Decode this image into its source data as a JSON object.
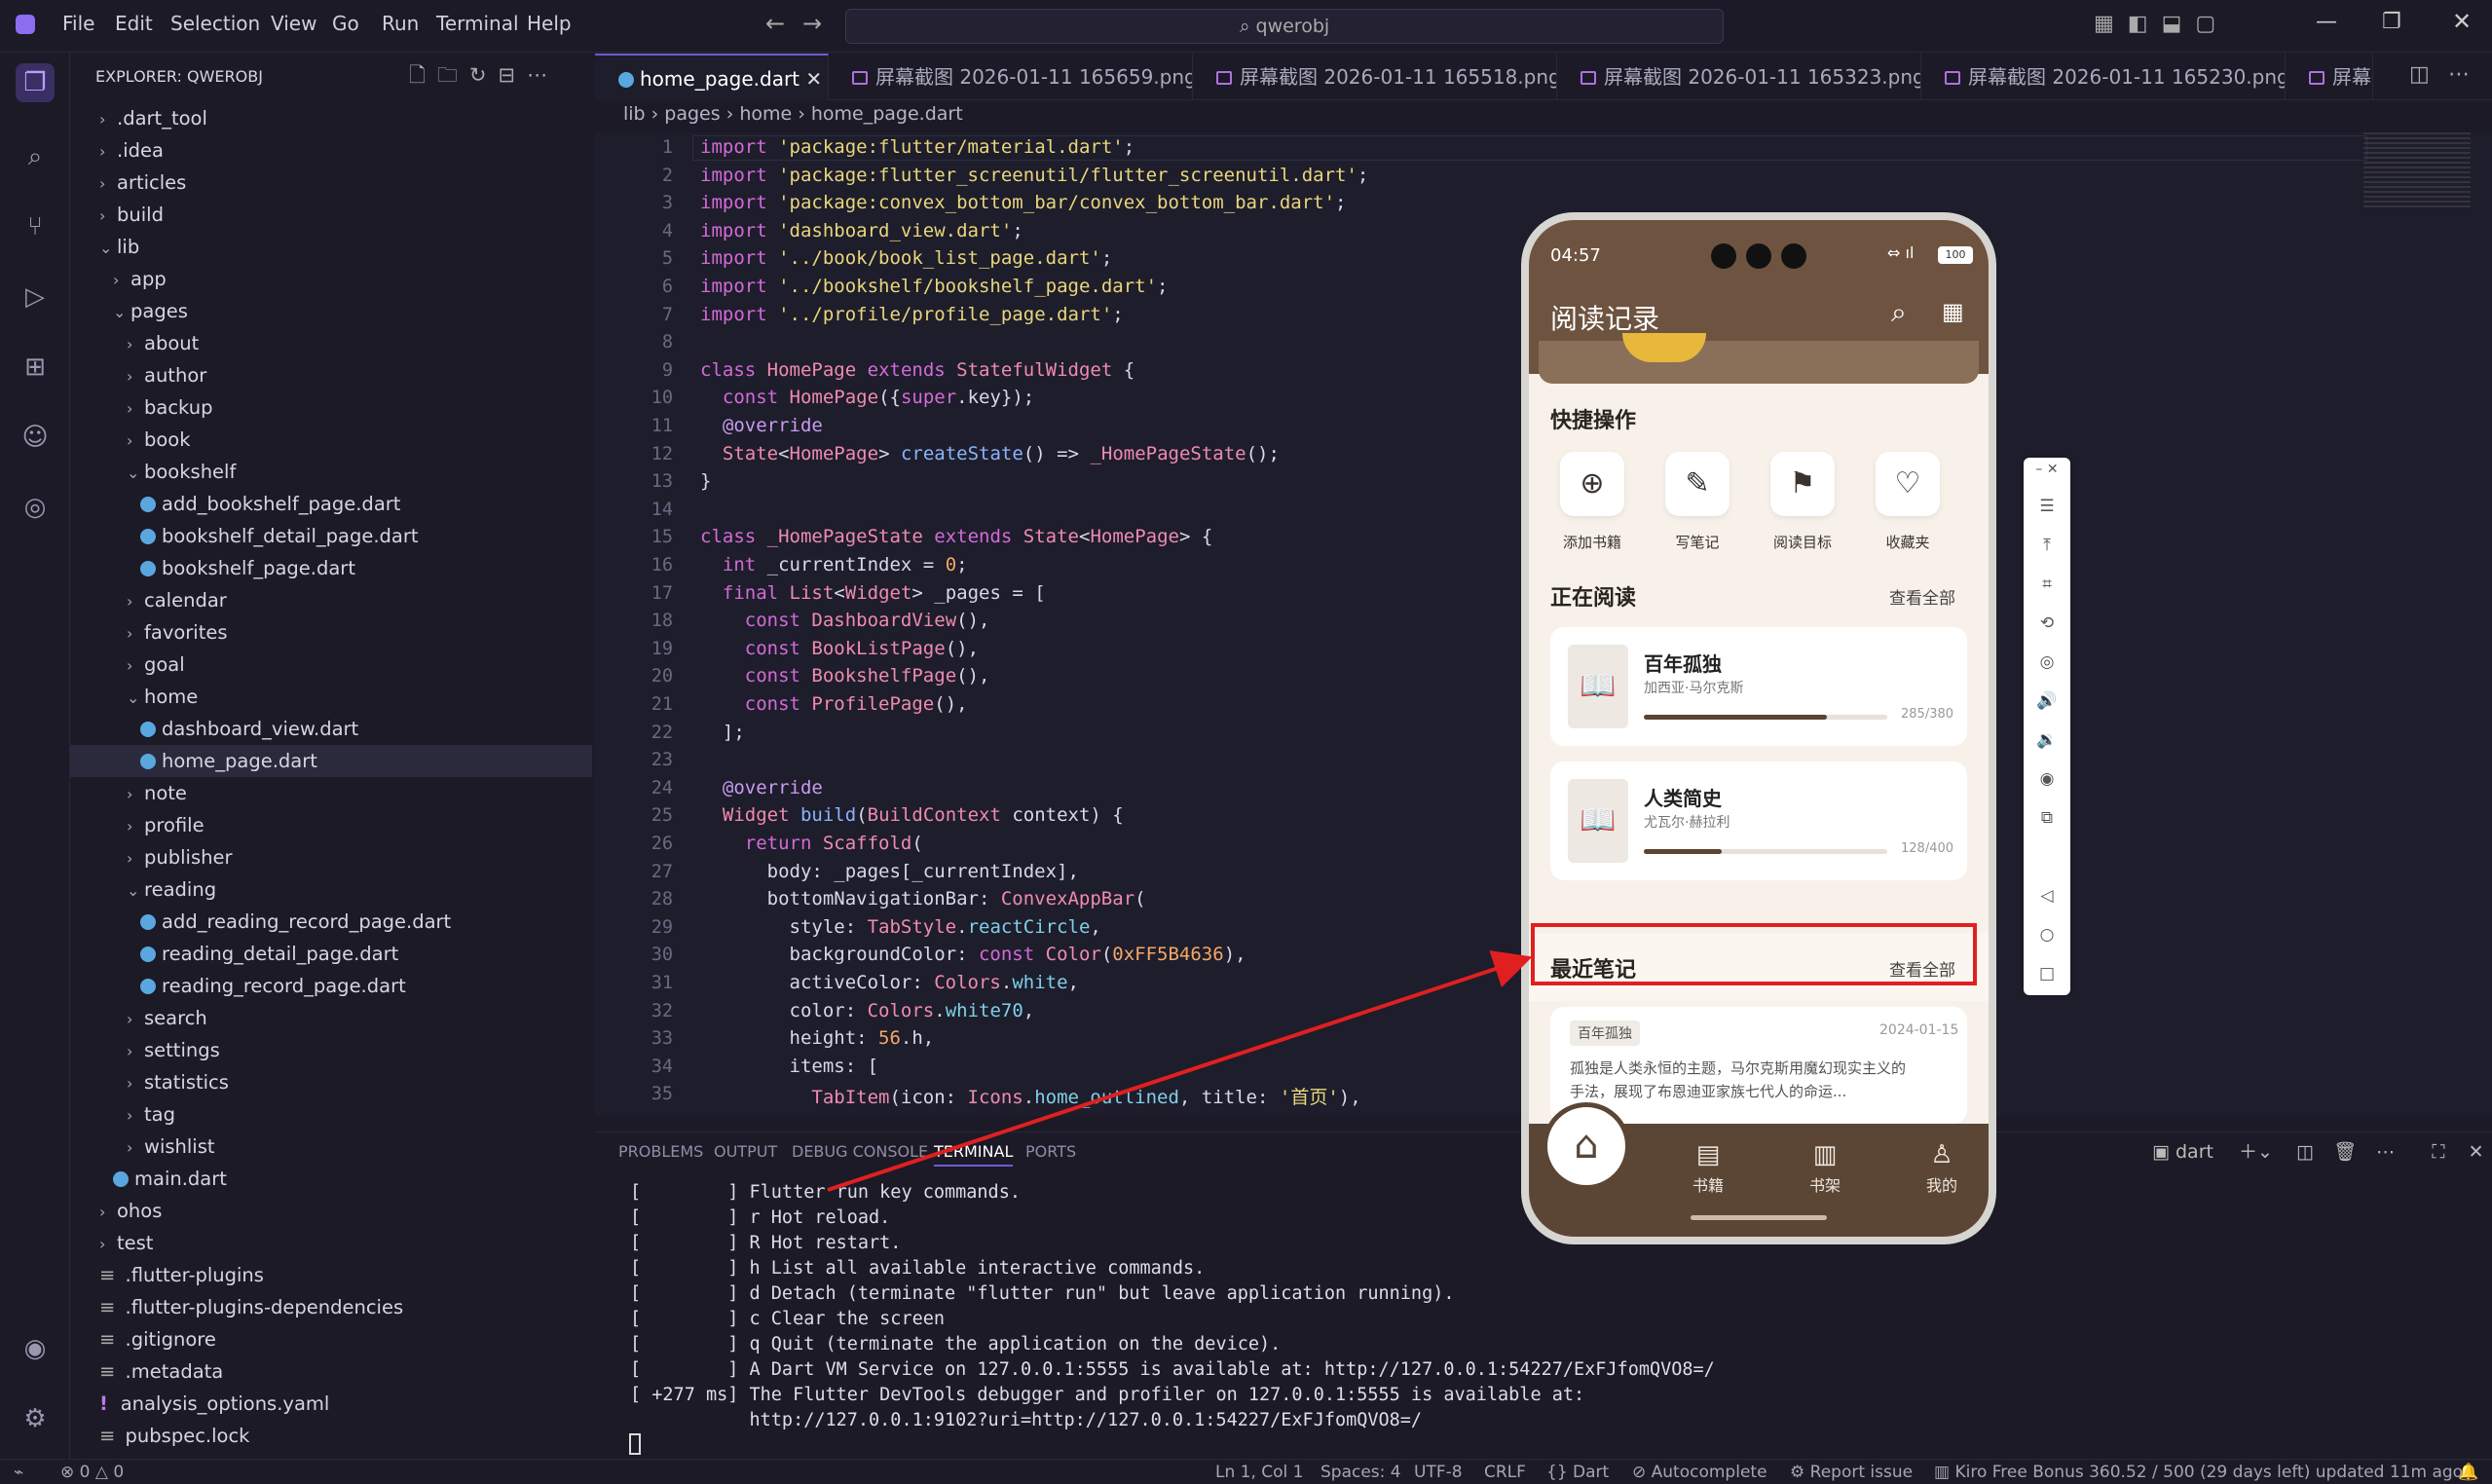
{
  "menu": [
    "File",
    "Edit",
    "Selection",
    "View",
    "Go",
    "Run",
    "Terminal",
    "Help"
  ],
  "search": {
    "text": "qwerobj"
  },
  "explorer": {
    "title": "EXPLORER: QWEROBJ",
    "items": [
      {
        "label": ".dart_tool",
        "kind": "folder",
        "open": false,
        "depth": 1
      },
      {
        "label": ".idea",
        "kind": "folder",
        "open": false,
        "depth": 1
      },
      {
        "label": "articles",
        "kind": "folder",
        "open": false,
        "depth": 1
      },
      {
        "label": "build",
        "kind": "folder",
        "open": false,
        "depth": 1
      },
      {
        "label": "lib",
        "kind": "folder",
        "open": true,
        "depth": 1
      },
      {
        "label": "app",
        "kind": "folder",
        "open": false,
        "depth": 2
      },
      {
        "label": "pages",
        "kind": "folder",
        "open": true,
        "depth": 2
      },
      {
        "label": "about",
        "kind": "folder",
        "open": false,
        "depth": 3
      },
      {
        "label": "author",
        "kind": "folder",
        "open": false,
        "depth": 3
      },
      {
        "label": "backup",
        "kind": "folder",
        "open": false,
        "depth": 3
      },
      {
        "label": "book",
        "kind": "folder",
        "open": false,
        "depth": 3
      },
      {
        "label": "bookshelf",
        "kind": "folder",
        "open": true,
        "depth": 3
      },
      {
        "label": "add_bookshelf_page.dart",
        "kind": "dart",
        "depth": 4
      },
      {
        "label": "bookshelf_detail_page.dart",
        "kind": "dart",
        "depth": 4
      },
      {
        "label": "bookshelf_page.dart",
        "kind": "dart",
        "depth": 4
      },
      {
        "label": "calendar",
        "kind": "folder",
        "open": false,
        "depth": 3
      },
      {
        "label": "favorites",
        "kind": "folder",
        "open": false,
        "depth": 3
      },
      {
        "label": "goal",
        "kind": "folder",
        "open": false,
        "depth": 3
      },
      {
        "label": "home",
        "kind": "folder",
        "open": true,
        "depth": 3
      },
      {
        "label": "dashboard_view.dart",
        "kind": "dart",
        "depth": 4
      },
      {
        "label": "home_page.dart",
        "kind": "dart",
        "depth": 4,
        "selected": true
      },
      {
        "label": "note",
        "kind": "folder",
        "open": false,
        "depth": 3
      },
      {
        "label": "profile",
        "kind": "folder",
        "open": false,
        "depth": 3
      },
      {
        "label": "publisher",
        "kind": "folder",
        "open": false,
        "depth": 3
      },
      {
        "label": "reading",
        "kind": "folder",
        "open": true,
        "depth": 3
      },
      {
        "label": "add_reading_record_page.dart",
        "kind": "dart",
        "depth": 4
      },
      {
        "label": "reading_detail_page.dart",
        "kind": "dart",
        "depth": 4
      },
      {
        "label": "reading_record_page.dart",
        "kind": "dart",
        "depth": 4
      },
      {
        "label": "search",
        "kind": "folder",
        "open": false,
        "depth": 3
      },
      {
        "label": "settings",
        "kind": "folder",
        "open": false,
        "depth": 3
      },
      {
        "label": "statistics",
        "kind": "folder",
        "open": false,
        "depth": 3
      },
      {
        "label": "tag",
        "kind": "folder",
        "open": false,
        "depth": 3
      },
      {
        "label": "wishlist",
        "kind": "folder",
        "open": false,
        "depth": 3
      },
      {
        "label": "main.dart",
        "kind": "dart",
        "depth": 2
      },
      {
        "label": "ohos",
        "kind": "folder",
        "open": false,
        "depth": 1
      },
      {
        "label": "test",
        "kind": "folder",
        "open": false,
        "depth": 1
      },
      {
        "label": ".flutter-plugins",
        "kind": "file",
        "depth": 1
      },
      {
        "label": ".flutter-plugins-dependencies",
        "kind": "file",
        "depth": 1
      },
      {
        "label": ".gitignore",
        "kind": "file",
        "depth": 1
      },
      {
        "label": ".metadata",
        "kind": "file",
        "depth": 1
      },
      {
        "label": "analysis_options.yaml",
        "kind": "yaml",
        "depth": 1
      },
      {
        "label": "pubspec.lock",
        "kind": "file",
        "depth": 1
      }
    ]
  },
  "tabs": [
    {
      "label": "home_page.dart",
      "active": true,
      "kind": "dart"
    },
    {
      "label": "屏幕截图 2026-01-11 165659.png",
      "kind": "png"
    },
    {
      "label": "屏幕截图 2026-01-11 165518.png",
      "kind": "png"
    },
    {
      "label": "屏幕截图 2026-01-11 165323.png",
      "kind": "png"
    },
    {
      "label": "屏幕截图 2026-01-11 165230.png",
      "kind": "png"
    },
    {
      "label": "屏幕截",
      "kind": "png"
    }
  ],
  "breadcrumb": "lib › pages › home › home_page.dart",
  "code_lines": [
    "<span class=kw>import</span> <span class=str>'package:flutter/material.dart'</span>;",
    "<span class=kw>import</span> <span class=str>'package:flutter_screenutil/flutter_screenutil.dart'</span>;",
    "<span class=kw>import</span> <span class=str>'package:convex_bottom_bar/convex_bottom_bar.dart'</span>;",
    "<span class=kw>import</span> <span class=str>'dashboard_view.dart'</span>;",
    "<span class=kw>import</span> <span class=str>'../book/book_list_page.dart'</span>;",
    "<span class=kw>import</span> <span class=str>'../bookshelf/bookshelf_page.dart'</span>;",
    "<span class=kw>import</span> <span class=str>'../profile/profile_page.dart'</span>;",
    "",
    "<span class=kw>class</span> <span class=typ>HomePage</span> <span class=kw>extends</span> <span class=typ>StatefulWidget</span> {",
    "  <span class=kw>const</span> <span class=typ>HomePage</span>({<span class=kw>super</span>.key});",
    "  <span class=ann>@override</span>",
    "  <span class=typ>State</span>&lt;<span class=typ>HomePage</span>&gt; <span class=fn>createState</span>() =&gt; <span class=typ>_HomePageState</span>();",
    "}",
    "",
    "<span class=kw>class</span> <span class=typ>_HomePageState</span> <span class=kw>extends</span> <span class=typ>State</span>&lt;<span class=typ>HomePage</span>&gt; {",
    "  <span class=kw>int</span> _currentIndex = <span class=num>0</span>;",
    "  <span class=kw>final</span> <span class=typ>List</span>&lt;<span class=typ>Widget</span>&gt; _pages = [",
    "    <span class=kw>const</span> <span class=typ>DashboardView</span>(),",
    "    <span class=kw>const</span> <span class=typ>BookListPage</span>(),",
    "    <span class=kw>const</span> <span class=typ>BookshelfPage</span>(),",
    "    <span class=kw>const</span> <span class=typ>ProfilePage</span>(),",
    "  ];",
    "",
    "  <span class=ann>@override</span>",
    "  <span class=typ>Widget</span> <span class=fn>build</span>(<span class=typ>BuildContext</span> context) {",
    "    <span class=kw>return</span> <span class=typ>Scaffold</span>(",
    "      body: _pages[_currentIndex],",
    "      bottomNavigationBar: <span class=typ>ConvexAppBar</span>(",
    "        style: <span class=typ>TabStyle</span>.<span class=prop>reactCircle</span>,",
    "        backgroundColor: <span class=kw>const</span> <span class=typ>Color</span>(<span class=num>0xFF5B4636</span>),",
    "        activeColor: <span class=typ>Colors</span>.<span class=prop>white</span>,",
    "        color: <span class=typ>Colors</span>.<span class=prop>white70</span>,",
    "        height: <span class=num>56</span>.h,",
    "        items: [",
    "          <span class=typ>TabItem</span>(icon: <span class=typ>Icons</span>.<span class=prop>home_outlined</span>, title: <span class=str>'首页'</span>),"
  ],
  "panel_tabs": [
    "PROBLEMS",
    "OUTPUT",
    "DEBUG CONSOLE",
    "TERMINAL",
    "PORTS"
  ],
  "terminal_shell": "dart",
  "terminal_lines": [
    "[        ] Flutter run key commands.",
    "[        ] r Hot reload.",
    "[        ] R Hot restart.",
    "[        ] h List all available interactive commands.",
    "[        ] d Detach (terminate \"flutter run\" but leave application running).",
    "[        ] c Clear the screen",
    "[        ] q Quit (terminate the application on the device).",
    "[        ] A Dart VM Service on 127.0.0.1:5555 is available at: http://127.0.0.1:54227/ExFJfomQVO8=/",
    "[ +277 ms] The Flutter DevTools debugger and profiler on 127.0.0.1:5555 is available at:",
    "           http://127.0.0.1:9102?uri=http://127.0.0.1:54227/ExFJfomQVO8=/"
  ],
  "status": {
    "errors": "0",
    "warnings": "0",
    "position": "Ln 1, Col 1",
    "spaces": "Spaces: 4",
    "encoding": "UTF-8",
    "eol": "CRLF",
    "lang": "Dart",
    "autocomplete": "Autocomplete",
    "report": "Report issue",
    "bonus": "Kiro Free Bonus 360.52 / 500 (29 days left) updated 11m ago"
  },
  "phone": {
    "time": "04:57",
    "battery": "100",
    "title": "阅读记录",
    "quick_title": "快捷操作",
    "quick_actions": [
      {
        "icon": "add-circle-icon",
        "glyph": "⊕",
        "label": "添加书籍"
      },
      {
        "icon": "edit-note-icon",
        "glyph": "✎",
        "label": "写笔记"
      },
      {
        "icon": "flag-icon",
        "glyph": "⚑",
        "label": "阅读目标"
      },
      {
        "icon": "heart-icon",
        "glyph": "♡",
        "label": "收藏夹"
      }
    ],
    "reading_title": "正在阅读",
    "view_all": "查看全部",
    "books": [
      {
        "title": "百年孤独",
        "author": "加西亚·马尔克斯",
        "progress": "285/380",
        "ratio": 0.75
      },
      {
        "title": "人类简史",
        "author": "尤瓦尔·赫拉利",
        "progress": "128/400",
        "ratio": 0.32
      }
    ],
    "notes_title": "最近笔记",
    "note": {
      "tag": "百年孤独",
      "date": "2024-01-15",
      "text1": "孤独是人类永恒的主题，马尔克斯用魔幻现实主义的",
      "text2": "手法，展现了布恩迪亚家族七代人的命运..."
    },
    "nav": [
      {
        "label": "书籍",
        "icon": "book-icon"
      },
      {
        "label": "书架",
        "icon": "bookshelf-icon"
      },
      {
        "label": "我的",
        "icon": "person-icon"
      }
    ]
  },
  "colors": {
    "accent": "#6b5dd3",
    "brand": "#5B4636",
    "annotation": "#e02020"
  }
}
